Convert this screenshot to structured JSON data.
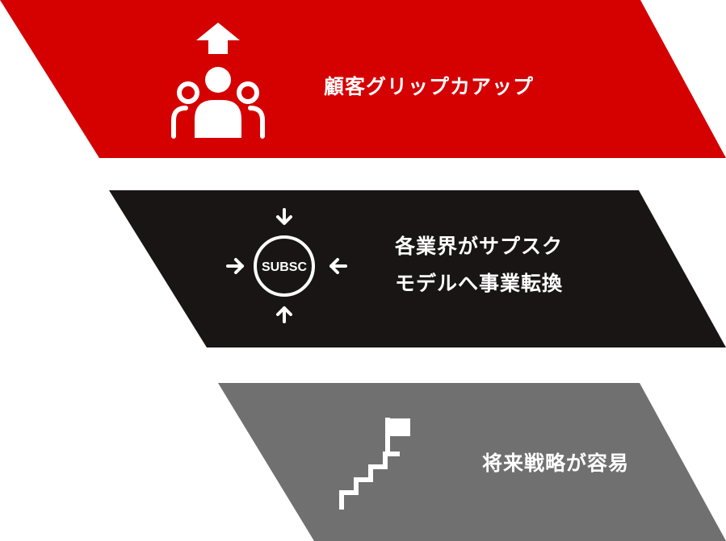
{
  "colors": {
    "band_1": "#d50000",
    "band_2": "#191515",
    "band_3": "#707070",
    "foreground": "#ffffff"
  },
  "bands": [
    {
      "icon": "users-up-arrow-icon",
      "lines": [
        "顧客グリップカアップ"
      ]
    },
    {
      "icon": "subscription-arrows-icon",
      "icon_text": "SUBSC",
      "lines": [
        "各業界がサプスク",
        "モデルへ事業転換"
      ]
    },
    {
      "icon": "stairs-flag-icon",
      "lines": [
        "将来戦略が容易"
      ]
    }
  ]
}
